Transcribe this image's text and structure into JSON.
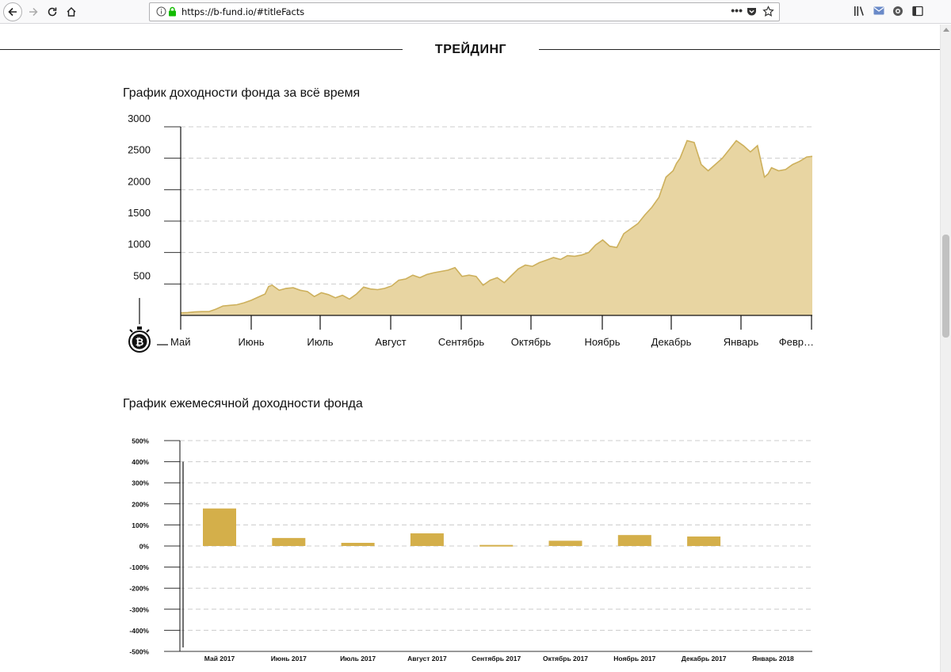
{
  "browser": {
    "url": "https://b-fund.io/#titleFacts",
    "dots": "•••"
  },
  "section": {
    "title": "ТРЕЙДИНГ"
  },
  "colors": {
    "accent": "#d4af4a",
    "area_fill": "#e8d5a2",
    "area_line": "#cdb05c",
    "grid": "#cccccc"
  },
  "chart_data": [
    {
      "type": "area",
      "title": "График доходности фонда за всё время",
      "xlabel": "",
      "ylabel": "",
      "ylim": [
        0,
        3000
      ],
      "yticks": [
        "500",
        "1000",
        "1500",
        "2000",
        "2500",
        "3000"
      ],
      "xticks": [
        "Май",
        "Июнь",
        "Июль",
        "Август",
        "Сентябрь",
        "Октябрь",
        "Ноябрь",
        "Декабрь",
        "Январь",
        "Февр…"
      ],
      "grid": true,
      "icon": "bitcoin-stopwatch-icon",
      "x": [
        0.0,
        0.1,
        0.2,
        0.3,
        0.4,
        0.5,
        0.6,
        0.7,
        0.8,
        0.9,
        1.0,
        1.1,
        1.2,
        1.25,
        1.3,
        1.4,
        1.5,
        1.6,
        1.7,
        1.8,
        1.9,
        2.0,
        2.1,
        2.2,
        2.3,
        2.4,
        2.5,
        2.6,
        2.7,
        2.8,
        2.9,
        3.0,
        3.1,
        3.2,
        3.3,
        3.4,
        3.5,
        3.6,
        3.7,
        3.8,
        3.9,
        4.0,
        4.1,
        4.2,
        4.3,
        4.4,
        4.5,
        4.6,
        4.7,
        4.8,
        4.9,
        5.0,
        5.1,
        5.2,
        5.3,
        5.4,
        5.5,
        5.6,
        5.7,
        5.8,
        5.9,
        6.0,
        6.1,
        6.2,
        6.3,
        6.4,
        6.5,
        6.6,
        6.7,
        6.8,
        6.9,
        7.0,
        7.05,
        7.1,
        7.2,
        7.3,
        7.4,
        7.45,
        7.5,
        7.6,
        7.7,
        7.8,
        7.9,
        8.0,
        8.1,
        8.2,
        8.3,
        8.35,
        8.4,
        8.5,
        8.6,
        8.7,
        8.8,
        8.9,
        8.98
      ],
      "values": [
        40,
        45,
        55,
        60,
        60,
        100,
        150,
        160,
        170,
        200,
        240,
        290,
        340,
        460,
        480,
        400,
        430,
        440,
        400,
        380,
        300,
        360,
        330,
        280,
        320,
        260,
        340,
        450,
        420,
        410,
        430,
        470,
        560,
        580,
        640,
        600,
        650,
        680,
        700,
        720,
        760,
        620,
        640,
        620,
        480,
        560,
        600,
        520,
        630,
        740,
        800,
        780,
        840,
        880,
        920,
        890,
        950,
        940,
        960,
        1000,
        1120,
        1200,
        1100,
        1080,
        1300,
        1380,
        1460,
        1600,
        1720,
        1880,
        2200,
        2300,
        2420,
        2500,
        2780,
        2750,
        2400,
        2350,
        2300,
        2400,
        2500,
        2640,
        2780,
        2700,
        2600,
        2700,
        2200,
        2250,
        2350,
        2300,
        2320,
        2400,
        2450,
        2520,
        2530
      ]
    },
    {
      "type": "bar",
      "title": "График ежемесячной доходности фонда",
      "xlabel": "",
      "ylabel": "",
      "ylim": [
        -500,
        500
      ],
      "yticks": [
        "500%",
        "400%",
        "300%",
        "200%",
        "100%",
        "0%",
        "-100%",
        "-200%",
        "-300%",
        "-400%",
        "-500%"
      ],
      "categories": [
        "Май 2017",
        "Июнь 2017",
        "Июль 2017",
        "Август 2017",
        "Сентябрь 2017",
        "Октябрь 2017",
        "Ноябрь 2017",
        "Декабрь 2017",
        "Январь 2018"
      ],
      "values": [
        178,
        38,
        15,
        60,
        5,
        25,
        52,
        45,
        0
      ],
      "grid": true
    }
  ]
}
